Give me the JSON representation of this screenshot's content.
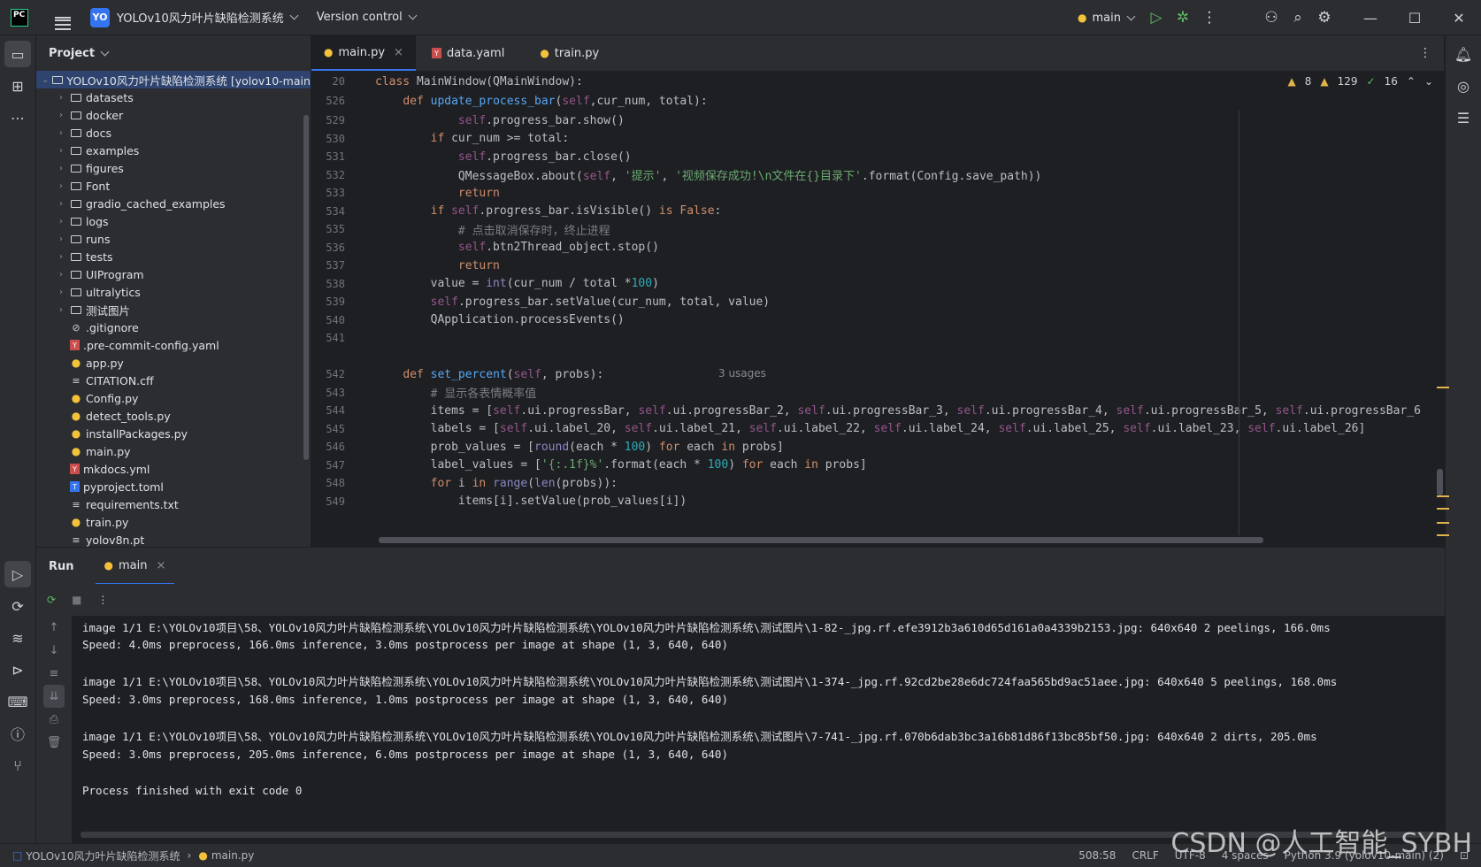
{
  "titlebar": {
    "logo": "PC",
    "project_badge": "YO",
    "project_name": "YOLOv10风力叶片缺陷检测系统",
    "vcs_label": "Version control",
    "run_config": "main"
  },
  "project_panel": {
    "title": "Project",
    "root": "YOLOv10风力叶片缺陷检测系统 [yolov10-main]",
    "items": [
      {
        "label": "datasets",
        "type": "folder"
      },
      {
        "label": "docker",
        "type": "folder"
      },
      {
        "label": "docs",
        "type": "folder"
      },
      {
        "label": "examples",
        "type": "folder"
      },
      {
        "label": "figures",
        "type": "folder"
      },
      {
        "label": "Font",
        "type": "folder"
      },
      {
        "label": "gradio_cached_examples",
        "type": "folder"
      },
      {
        "label": "logs",
        "type": "folder"
      },
      {
        "label": "runs",
        "type": "folder"
      },
      {
        "label": "tests",
        "type": "folder"
      },
      {
        "label": "UIProgram",
        "type": "folder"
      },
      {
        "label": "ultralytics",
        "type": "folder"
      },
      {
        "label": "测试图片",
        "type": "folder"
      },
      {
        "label": ".gitignore",
        "type": "ignore"
      },
      {
        "label": ".pre-commit-config.yaml",
        "type": "yml"
      },
      {
        "label": "app.py",
        "type": "py"
      },
      {
        "label": "CITATION.cff",
        "type": "txt"
      },
      {
        "label": "Config.py",
        "type": "py"
      },
      {
        "label": "detect_tools.py",
        "type": "py"
      },
      {
        "label": "installPackages.py",
        "type": "py"
      },
      {
        "label": "main.py",
        "type": "py"
      },
      {
        "label": "mkdocs.yml",
        "type": "yml"
      },
      {
        "label": "pyproject.toml",
        "type": "toml"
      },
      {
        "label": "requirements.txt",
        "type": "txt"
      },
      {
        "label": "train.py",
        "type": "py"
      },
      {
        "label": "yolov8n.pt",
        "type": "txt"
      }
    ]
  },
  "editor": {
    "tabs": [
      {
        "label": "main.py",
        "active": true
      },
      {
        "label": "data.yaml",
        "active": false
      },
      {
        "label": "train.py",
        "active": false
      }
    ],
    "inspections": {
      "warnings": "8",
      "weak_warnings": "129",
      "ok": "16"
    },
    "usages_hint": "3 usages",
    "lines": [
      {
        "n": "20",
        "html": "<span class=\"kw\">class</span> MainWindow(QMainWindow):"
      },
      {
        "n": "526",
        "html": "    <span class=\"kw\">def</span> <span class=\"fn\">update_process_bar</span>(<span class=\"sf\">self</span>,cur_num, total):"
      },
      {
        "n": "529",
        "html": "            <span class=\"sf\">self</span>.progress_bar.show()"
      },
      {
        "n": "530",
        "html": "        <span class=\"kw\">if</span> cur_num >= total:"
      },
      {
        "n": "531",
        "html": "            <span class=\"sf\">self</span>.progress_bar.close()"
      },
      {
        "n": "532",
        "html": "            QMessageBox.about(<span class=\"sf\">self</span>, <span class=\"str\">'提示'</span>, <span class=\"str\">'视频保存成功!\\n文件在{}目录下'</span>.format(Config.save_path))"
      },
      {
        "n": "533",
        "html": "            <span class=\"kw\">return</span>"
      },
      {
        "n": "534",
        "html": "        <span class=\"kw\">if</span> <span class=\"sf\">self</span>.progress_bar.isVisible() <span class=\"kw\">is</span> <span class=\"kw\">False</span>:"
      },
      {
        "n": "535",
        "html": "            <span class=\"cm\"># 点击取消保存时，终止进程</span>"
      },
      {
        "n": "536",
        "html": "            <span class=\"sf\">self</span>.btn2Thread_object.stop()"
      },
      {
        "n": "537",
        "html": "            <span class=\"kw\">return</span>"
      },
      {
        "n": "538",
        "html": "        value = <span class=\"bi\">int</span>(cur_num / total *<span class=\"num\">100</span>)"
      },
      {
        "n": "539",
        "html": "        <span class=\"sf\">self</span>.progress_bar.setValue(cur_num, total, value)"
      },
      {
        "n": "540",
        "html": "        QApplication.processEvents()"
      },
      {
        "n": "541",
        "html": ""
      },
      {
        "n": "542",
        "html": "    <span class=\"kw\">def</span> <span class=\"fn\">set_percent</span>(<span class=\"sf\">self</span>, probs):"
      },
      {
        "n": "543",
        "html": "        <span class=\"cm\"># 显示各表情概率值</span>"
      },
      {
        "n": "544",
        "html": "        items = [<span class=\"sf\">self</span>.ui.progressBar, <span class=\"sf\">self</span>.ui.progressBar_2, <span class=\"sf\">self</span>.ui.progressBar_3, <span class=\"sf\">self</span>.ui.progressBar_4, <span class=\"sf\">self</span>.ui.progressBar_5, <span class=\"sf\">self</span>.ui.progressBar_6"
      },
      {
        "n": "545",
        "html": "        labels = [<span class=\"sf\">self</span>.ui.label_20, <span class=\"sf\">self</span>.ui.label_21, <span class=\"sf\">self</span>.ui.label_22, <span class=\"sf\">self</span>.ui.label_24, <span class=\"sf\">self</span>.ui.label_25, <span class=\"sf\">self</span>.ui.label_23, <span class=\"sf\">self</span>.ui.label_26]"
      },
      {
        "n": "546",
        "html": "        prob_values = [<span class=\"bi\">round</span>(each * <span class=\"num\">100</span>) <span class=\"kw\">for</span> each <span class=\"kw\">in</span> probs]"
      },
      {
        "n": "547",
        "html": "        label_values = [<span class=\"str\">'{:.1f}%'</span>.format(each * <span class=\"num\">100</span>) <span class=\"kw\">for</span> each <span class=\"kw\">in</span> probs]"
      },
      {
        "n": "548",
        "html": "        <span class=\"kw\">for</span> i <span class=\"kw\">in</span> <span class=\"bi\">range</span>(<span class=\"bi\">len</span>(probs)):"
      },
      {
        "n": "549",
        "html": "            items[i].setValue(prob_values[i])"
      }
    ]
  },
  "run_panel": {
    "title": "Run",
    "tab": "main",
    "lines": [
      "image 1/1 E:\\YOLOv10项目\\58、YOLOv10风力叶片缺陷检测系统\\YOLOv10风力叶片缺陷检测系统\\YOLOv10风力叶片缺陷检测系统\\测试图片\\1-82-_jpg.rf.efe3912b3a610d65d161a0a4339b2153.jpg: 640x640 2 peelings, 166.0ms",
      "Speed: 4.0ms preprocess, 166.0ms inference, 3.0ms postprocess per image at shape (1, 3, 640, 640)",
      "",
      "image 1/1 E:\\YOLOv10项目\\58、YOLOv10风力叶片缺陷检测系统\\YOLOv10风力叶片缺陷检测系统\\YOLOv10风力叶片缺陷检测系统\\测试图片\\1-374-_jpg.rf.92cd2be28e6dc724faa565bd9ac51aee.jpg: 640x640 5 peelings, 168.0ms",
      "Speed: 3.0ms preprocess, 168.0ms inference, 1.0ms postprocess per image at shape (1, 3, 640, 640)",
      "",
      "image 1/1 E:\\YOLOv10项目\\58、YOLOv10风力叶片缺陷检测系统\\YOLOv10风力叶片缺陷检测系统\\YOLOv10风力叶片缺陷检测系统\\测试图片\\7-741-_jpg.rf.070b6dab3bc3a16b81d86f13bc85bf50.jpg: 640x640 2 dirts, 205.0ms",
      "Speed: 3.0ms preprocess, 205.0ms inference, 6.0ms postprocess per image at shape (1, 3, 640, 640)",
      "",
      "Process finished with exit code 0"
    ]
  },
  "statusbar": {
    "breadcrumb_project": "YOLOv10风力叶片缺陷检测系统",
    "breadcrumb_file": "main.py",
    "position": "508:58",
    "line_sep": "CRLF",
    "encoding": "UTF-8",
    "indent": "4 spaces",
    "interpreter": "Python 3.9 (yolov10-main) (2)"
  },
  "watermark": "CSDN @人工智能_SYBH",
  "colors": {
    "accent": "#3574f0",
    "run_green": "#5fb865",
    "warning": "#e0b34b"
  }
}
